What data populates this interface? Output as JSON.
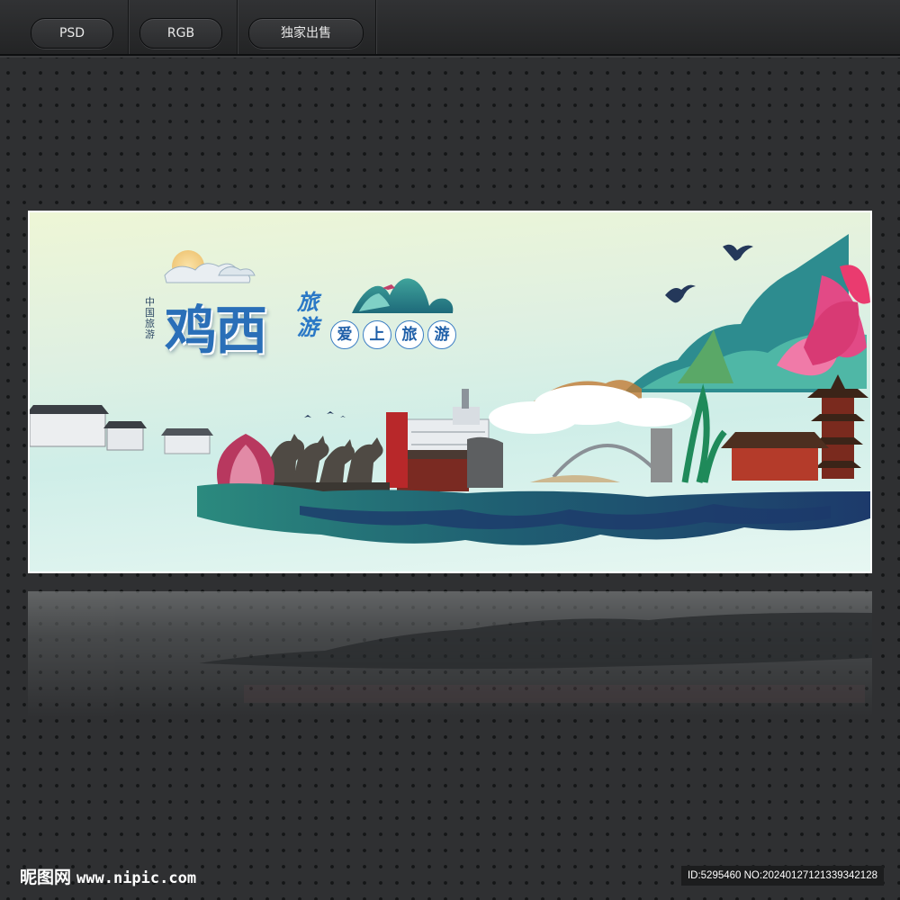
{
  "toolbar": {
    "psd_label": "PSD",
    "rgb_label": "RGB",
    "exclusive_label": "独家出售"
  },
  "poster": {
    "title": "鸡西",
    "title_side": "旅游",
    "vertical_text": "中国旅游",
    "slogan": [
      "爱",
      "上",
      "旅",
      "游"
    ]
  },
  "footer": {
    "site_name": "昵图网",
    "site_url": "www.nipic.com",
    "image_id": "ID:5295460 NO:20240127121339342128"
  },
  "colors": {
    "background": "#2f3032",
    "title_blue": "#2a6fb8",
    "ink_teal": "#1f6b6e",
    "ink_navy": "#1d3a6b",
    "lotus_pink": "#e04a86"
  }
}
